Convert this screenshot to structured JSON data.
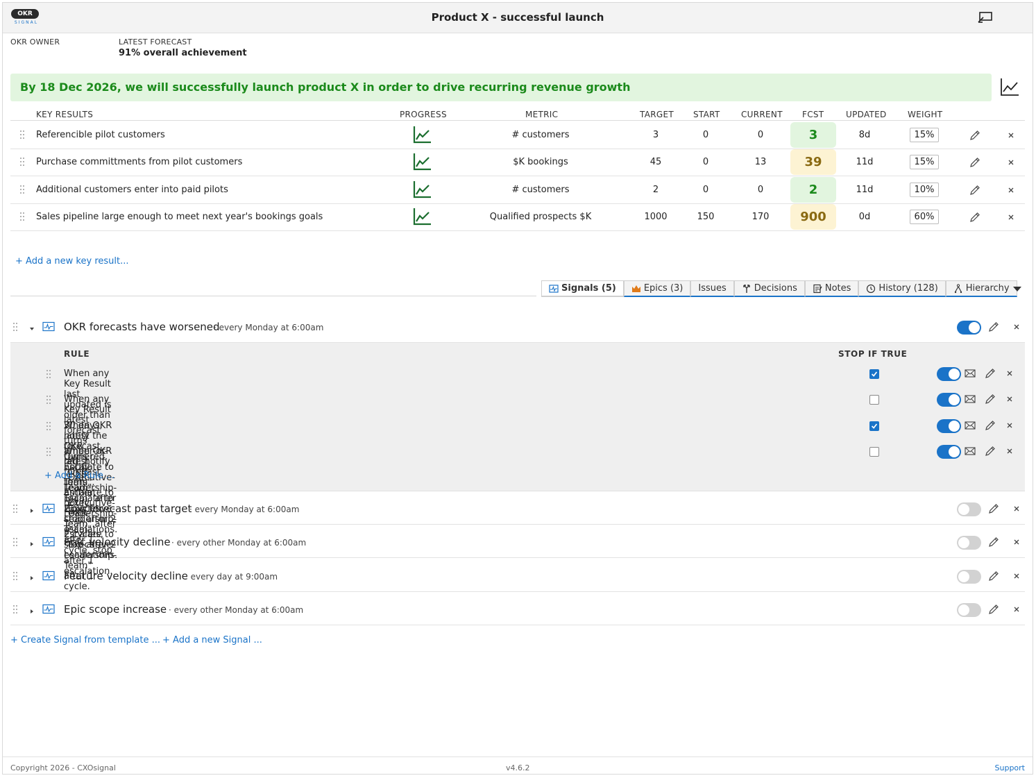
{
  "app": {
    "logo_text": "OKR",
    "logo_sub": "SIGNAL",
    "title": "Product X - successful launch"
  },
  "meta": {
    "owner_label": "OKR OWNER",
    "forecast_label": "LATEST FORECAST",
    "forecast_value": "91% overall achievement"
  },
  "objective": "By 18 Dec 2026, we will successfully launch product X in order to drive recurring revenue growth",
  "kr_columns": {
    "key_results": "KEY RESULTS",
    "progress": "PROGRESS",
    "metric": "METRIC",
    "target": "TARGET",
    "start": "START",
    "current": "CURRENT",
    "fcst": "FCST",
    "updated": "UPDATED",
    "weight": "WEIGHT"
  },
  "key_results": [
    {
      "name": "Referencible pilot customers",
      "metric": "# customers",
      "target": "3",
      "start": "0",
      "current": "0",
      "fcst": "3",
      "fcst_status": "green",
      "updated": "8d",
      "weight": "15%"
    },
    {
      "name": "Purchase committments from pilot customers",
      "metric": "$K bookings",
      "target": "45",
      "start": "0",
      "current": "13",
      "fcst": "39",
      "fcst_status": "amber",
      "updated": "11d",
      "weight": "15%"
    },
    {
      "name": "Additional customers enter into paid pilots",
      "metric": "# customers",
      "target": "2",
      "start": "0",
      "current": "0",
      "fcst": "2",
      "fcst_status": "green",
      "updated": "11d",
      "weight": "10%"
    },
    {
      "name": "Sales pipeline large enough to meet next year's bookings goals",
      "metric": "Qualified prospects $K",
      "target": "1000",
      "start": "150",
      "current": "170",
      "fcst": "900",
      "fcst_status": "amber",
      "updated": "0d",
      "weight": "60%"
    }
  ],
  "add_key_result": "+ Add a new key result...",
  "tabs": [
    {
      "label": "Signals (5)",
      "icon": "signal-icon",
      "active": true
    },
    {
      "label": "Epics (3)",
      "icon": "crown-icon"
    },
    {
      "label": "Issues",
      "icon": ""
    },
    {
      "label": "Decisions",
      "icon": "decision-icon"
    },
    {
      "label": "Notes",
      "icon": "notes-icon"
    },
    {
      "label": "History (128)",
      "icon": "history-icon"
    },
    {
      "label": "Hierarchy",
      "icon": "hierarchy-icon"
    }
  ],
  "signals": [
    {
      "name": "OKR forecasts have worsened",
      "schedule": "· every Monday at 6:00am",
      "enabled": true,
      "expanded": true
    },
    {
      "name": "Epic forecast past target",
      "schedule": "· every Monday at 6:00am",
      "enabled": false
    },
    {
      "name": "Epic velocity decline",
      "schedule": "· every other Monday at 6:00am",
      "enabled": false
    },
    {
      "name": "Feature velocity decline",
      "schedule": "· every day at 9:00am",
      "enabled": false
    },
    {
      "name": "Epic scope increase",
      "schedule": "· every other Monday at 6:00am",
      "enabled": false
    }
  ],
  "rules_header": {
    "rule": "RULE",
    "stop": "STOP IF TRUE"
  },
  "rules": [
    {
      "text": "When any Key Result last updated is older than 30 days, notify the OKR Owner. Escalate to \"Executive-Leadership-Team\" after 2 cycles, stop after 2 escalations.",
      "stop_if_true": true,
      "enabled": true
    },
    {
      "text": "When any Key Result latest forecast turns amber-or-red, notify \"OKR-Team\". Escalate to \"Executive-Leadership-Team\" after 2 cycles, stop after 2 escalations.",
      "stop_if_true": false,
      "enabled": true
    },
    {
      "text": "When OKR latest forecast turns red, notify \"OKR-Team\". Escalate to \"Executive-Leadership-Team\" after 1 cycle, stop after 1 escalation.",
      "stop_if_true": true,
      "enabled": true
    },
    {
      "text": "When OKR latest forecast turns amber, notify \"OKR-Team\". Escalate to \"Executive-Leadership-Team\" after 1 cycle.",
      "stop_if_true": false,
      "enabled": true
    }
  ],
  "add_rule": "+ Add a Rule ...",
  "create_signal": "+ Create Signal from template ...",
  "add_signal": "+ Add a new Signal ...",
  "footer": {
    "copyright": "Copyright 2026 - CXOsignal",
    "version": "v4.6.2",
    "support": "Support"
  },
  "colors": {
    "accent": "#1a73c8",
    "green": "#1b8a1b",
    "amber": "#8a6a12",
    "objective_bg": "#e2f5df"
  }
}
